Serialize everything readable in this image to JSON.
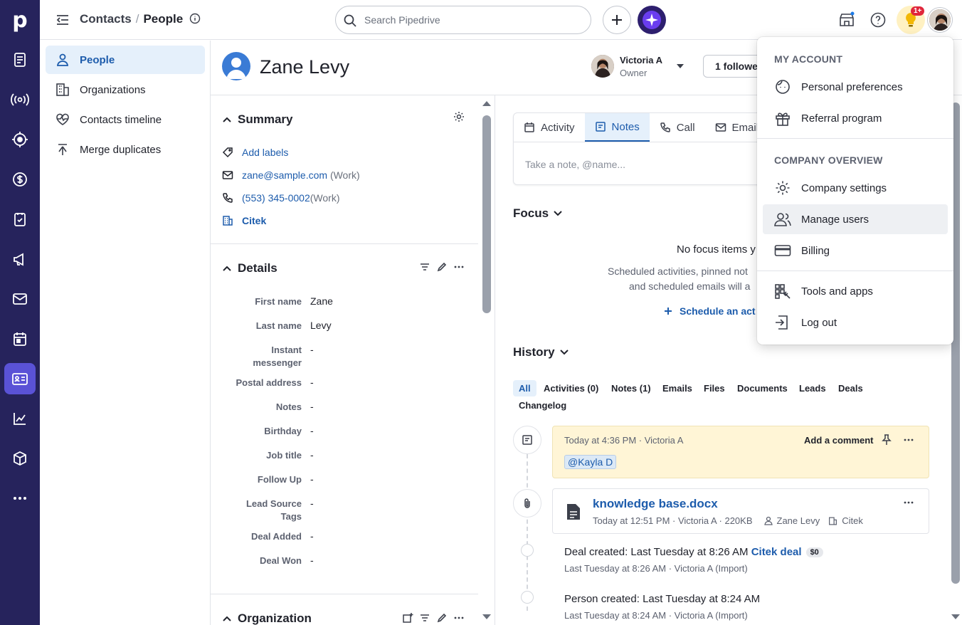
{
  "rail": {
    "logo": "p",
    "items": [
      {
        "icon": "leads-inbox-icon"
      },
      {
        "icon": "broadcast-icon"
      },
      {
        "icon": "target-icon"
      },
      {
        "icon": "deals-dollar-icon"
      },
      {
        "icon": "activities-icon"
      },
      {
        "icon": "campaigns-megaphone-icon"
      },
      {
        "icon": "mail-icon"
      },
      {
        "icon": "calendar-icon"
      },
      {
        "icon": "contacts-card-icon",
        "active": true
      },
      {
        "icon": "insights-chart-icon"
      },
      {
        "icon": "products-box-icon"
      },
      {
        "icon": "more-icon"
      }
    ]
  },
  "topbar": {
    "breadcrumb_parent": "Contacts",
    "breadcrumb_separator": "/",
    "breadcrumb_current": "People",
    "search_placeholder": "Search Pipedrive",
    "notification_badge": "1+"
  },
  "subnav": {
    "items": [
      {
        "label": "People",
        "icon": "person-icon",
        "active": true
      },
      {
        "label": "Organizations",
        "icon": "building-icon"
      },
      {
        "label": "Contacts timeline",
        "icon": "heart-pulse-icon"
      },
      {
        "label": "Merge duplicates",
        "icon": "merge-icon"
      }
    ]
  },
  "person": {
    "name": "Zane Levy",
    "owner_name": "Victoria A",
    "owner_role": "Owner",
    "followers": "1 followe"
  },
  "summary": {
    "title": "Summary",
    "add_labels": "Add labels",
    "email": "zane@sample.com",
    "email_type": "(Work)",
    "phone": "(553) 345-0002",
    "phone_type": "(Work)",
    "organization": "Citek"
  },
  "details": {
    "title": "Details",
    "fields": [
      {
        "label": "First name",
        "value": "Zane"
      },
      {
        "label": "Last name",
        "value": "Levy"
      },
      {
        "label": "Instant messenger",
        "value": "-"
      },
      {
        "label": "Postal address",
        "value": "-"
      },
      {
        "label": "Notes",
        "value": "-"
      },
      {
        "label": "Birthday",
        "value": "-"
      },
      {
        "label": "Job title",
        "value": "-"
      },
      {
        "label": "Follow Up",
        "value": "-"
      },
      {
        "label": "Lead Source Tags",
        "value": "-"
      },
      {
        "label": "Deal Added",
        "value": "-"
      },
      {
        "label": "Deal Won",
        "value": "-"
      }
    ]
  },
  "organization_section": {
    "title": "Organization"
  },
  "composer": {
    "tabs": [
      {
        "label": "Activity",
        "icon": "calendar-icon"
      },
      {
        "label": "Notes",
        "icon": "note-icon",
        "active": true
      },
      {
        "label": "Call",
        "icon": "phone-icon"
      },
      {
        "label": "Email",
        "icon": "mail-icon"
      }
    ],
    "placeholder": "Take a note, @name..."
  },
  "focus": {
    "title": "Focus",
    "empty_title": "No focus items y",
    "empty_line1": "Scheduled activities, pinned not",
    "empty_line2": "and scheduled emails will a",
    "schedule_link": "Schedule an act"
  },
  "history": {
    "title": "History",
    "filters": [
      "All",
      "Activities (0)",
      "Notes (1)",
      "Emails",
      "Files",
      "Documents",
      "Leads",
      "Deals",
      "Changelog"
    ],
    "note": {
      "meta": "Today at 4:36 PM · Victoria A",
      "add_comment": "Add a comment",
      "mention": "@Kayla D"
    },
    "file": {
      "name": "knowledge base.docx",
      "meta": "Today at 12:51 PM · Victoria A · 220KB",
      "person": "Zane Levy",
      "org": "Citek"
    },
    "deal_event": {
      "label": "Deal created",
      "time": "Last Tuesday at 8:26 AM",
      "deal_link": "Citek deal",
      "deal_value": "$0",
      "meta": "Last Tuesday at 8:26 AM · Victoria A (Import)"
    },
    "person_event": {
      "label": "Person created",
      "time": "Last Tuesday at 8:24 AM",
      "meta": "Last Tuesday at 8:24 AM · Victoria A (Import)"
    }
  },
  "account_menu": {
    "my_account_heading": "MY ACCOUNT",
    "my_account_items": [
      {
        "label": "Personal preferences",
        "icon": "face-icon"
      },
      {
        "label": "Referral program",
        "icon": "gift-icon"
      }
    ],
    "company_heading": "COMPANY OVERVIEW",
    "company_items": [
      {
        "label": "Company settings",
        "icon": "gear-icon"
      },
      {
        "label": "Manage users",
        "icon": "users-icon",
        "hover": true
      },
      {
        "label": "Billing",
        "icon": "credit-card-icon"
      }
    ],
    "other_items": [
      {
        "label": "Tools and apps",
        "icon": "tools-icon"
      },
      {
        "label": "Log out",
        "icon": "logout-icon"
      }
    ]
  },
  "colors": {
    "rail_bg": "#26235c",
    "rail_active": "#5a52d6",
    "link": "#1d5cac",
    "active_bg": "#e5f0fb",
    "note_bg": "#fff5d6"
  }
}
